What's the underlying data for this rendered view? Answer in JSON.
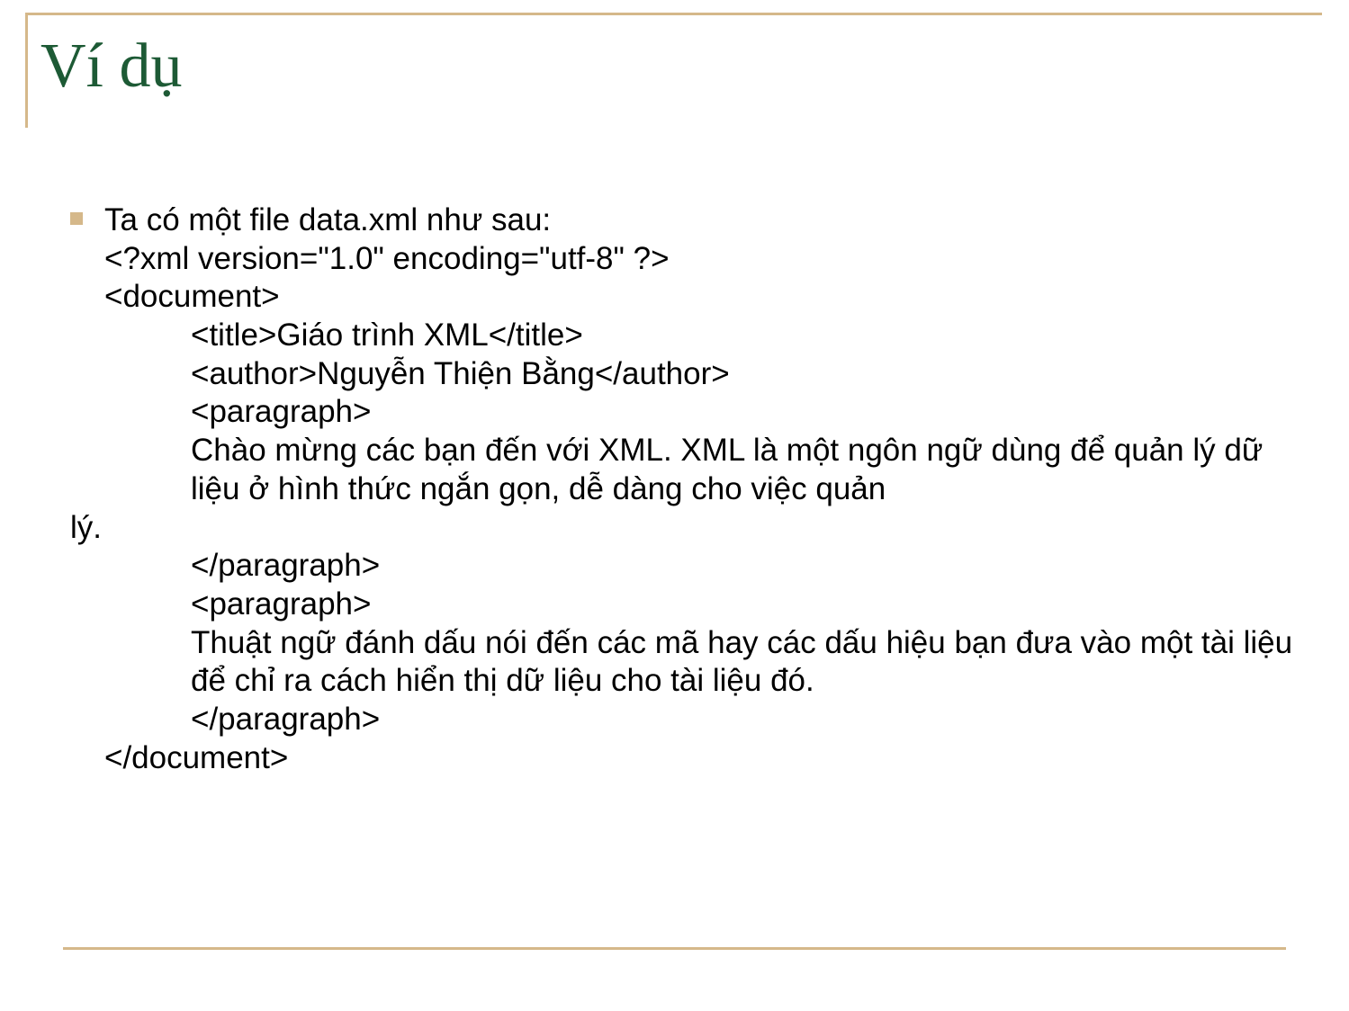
{
  "title": "Ví dụ",
  "bullet_lead": "Ta có một file data.xml như sau:",
  "lines": {
    "l1": "<?xml version=\"1.0\" encoding=\"utf-8\" ?>",
    "l2": "<document>",
    "l3": "<title>Giáo trình XML</title>",
    "l4": "<author>Nguyễn Thiện Bằng</author>",
    "l5": "<paragraph>",
    "l6": "Chào mừng các bạn đến với XML. XML là một ngôn ngữ dùng để quản lý dữ liệu ở hình thức ngắn gọn, dễ dàng cho việc  quản",
    "l6b": "lý.",
    "l7": "</paragraph>",
    "l8": "<paragraph>",
    "l9": "Thuật ngữ đánh dấu nói đến các mã hay các dấu hiệu bạn đưa vào một tài liệu để chỉ ra cách hiển thị dữ liệu cho tài liệu đó.",
    "l10": "</paragraph>",
    "l11": "</document>"
  }
}
